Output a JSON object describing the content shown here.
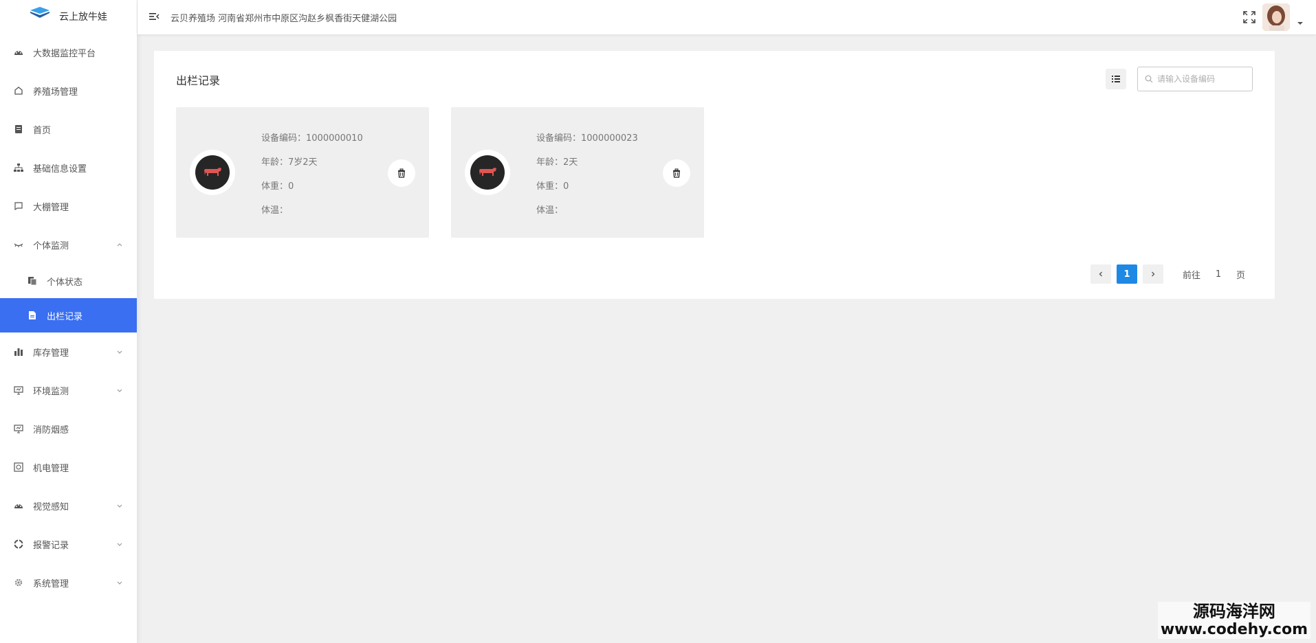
{
  "brand": {
    "name": "云上放牛娃",
    "logo_icon": "cube-logo-icon"
  },
  "sidebar": {
    "items": [
      {
        "label": "大数据监控平台",
        "icon": "dashboard-icon"
      },
      {
        "label": "养殖场管理",
        "icon": "farm-icon"
      },
      {
        "label": "首页",
        "icon": "document-icon"
      },
      {
        "label": "基础信息设置",
        "icon": "hierarchy-icon"
      },
      {
        "label": "大棚管理",
        "icon": "chat-square-icon"
      },
      {
        "label": "个体监测",
        "icon": "eye-icon",
        "expanded": true,
        "children": [
          {
            "label": "个体状态",
            "icon": "copy-icon"
          },
          {
            "label": "出栏记录",
            "icon": "file-icon",
            "active": true
          }
        ]
      },
      {
        "label": "库存管理",
        "icon": "bar-chart-icon"
      },
      {
        "label": "环境监测",
        "icon": "monitor-icon"
      },
      {
        "label": "消防烟感",
        "icon": "monitor-icon"
      },
      {
        "label": "机电管理",
        "icon": "safe-icon"
      },
      {
        "label": "视觉感知",
        "icon": "dashboard-icon"
      },
      {
        "label": "报警记录",
        "icon": "target-icon"
      },
      {
        "label": "系统管理",
        "icon": "gear-icon"
      }
    ],
    "active_color": "#3a6ff1"
  },
  "header": {
    "breadcrumb": "云贝养殖场 河南省郑州市中原区沟赵乡枫香街天健湖公园"
  },
  "main": {
    "title": "出栏记录",
    "search_placeholder": "请输入设备编码",
    "cards": [
      {
        "code_label": "设备编码：",
        "code": "1000000010",
        "age_label": "年龄：",
        "age": "7岁2天",
        "weight_label": "体重：",
        "weight": "0",
        "temp_label": "体温：",
        "temp": ""
      },
      {
        "code_label": "设备编码：",
        "code": "1000000023",
        "age_label": "年龄：",
        "age": "2天",
        "weight_label": "体重：",
        "weight": "0",
        "temp_label": "体温：",
        "temp": ""
      }
    ],
    "pagination": {
      "current": "1",
      "goto_prefix": "前往",
      "goto_value": "1",
      "goto_suffix": "页",
      "active_color": "#1e88e5"
    }
  },
  "watermark": {
    "line1": "源码海洋网",
    "line2": "www.codehy.com"
  }
}
